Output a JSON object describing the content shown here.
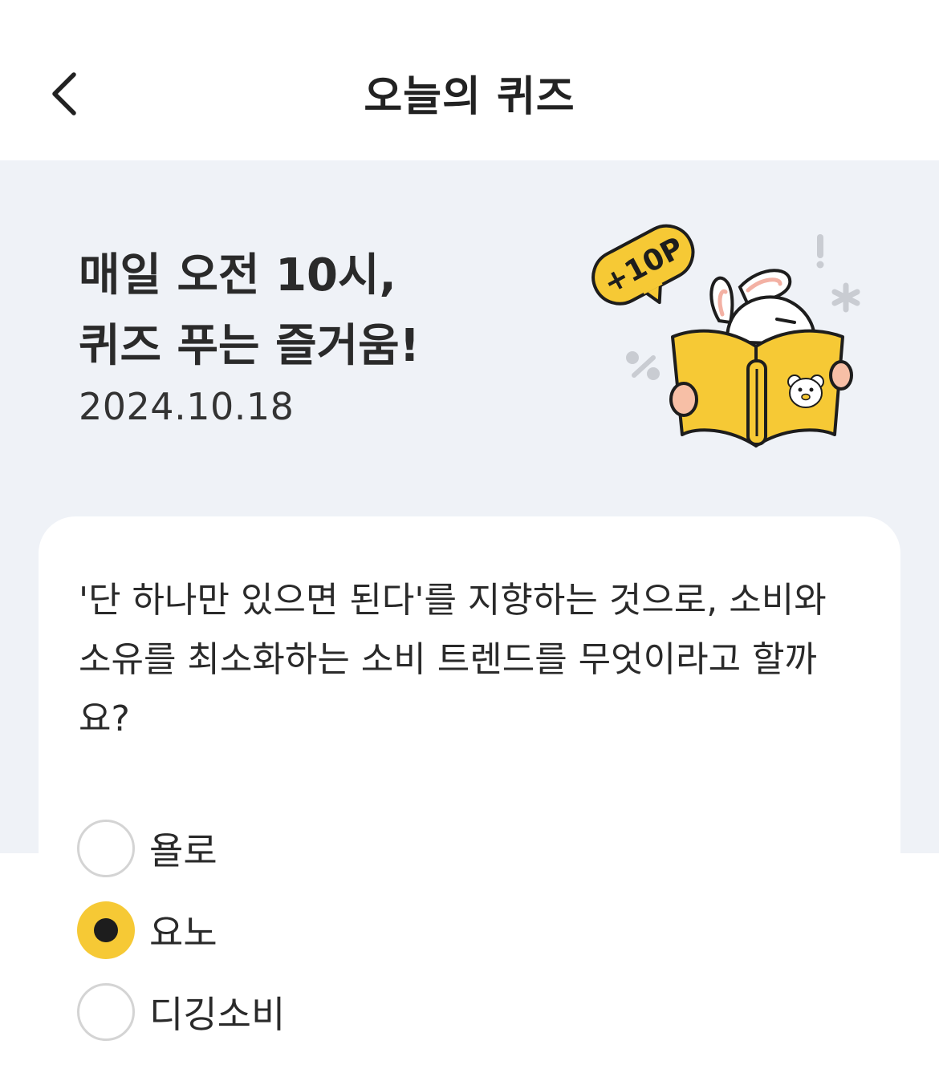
{
  "header": {
    "title": "오늘의 퀴즈",
    "back_icon": "chevron-left-icon"
  },
  "hero": {
    "title_line1": "매일 오전 10시,",
    "title_line2": "퀴즈 푸는 즐거움!",
    "date": "2024.10.18",
    "badge": "+10P",
    "accent_color": "#f6c935",
    "background_color": "#eff2f7"
  },
  "quiz": {
    "question": "'단 하나만 있으면 된다'를 지향하는 것으로, 소비와 소유를 최소화하는 소비 트렌드를 무엇이라고 할까요?",
    "options": [
      {
        "label": "욜로",
        "selected": false
      },
      {
        "label": "요노",
        "selected": true
      },
      {
        "label": "디깅소비",
        "selected": false
      }
    ]
  }
}
